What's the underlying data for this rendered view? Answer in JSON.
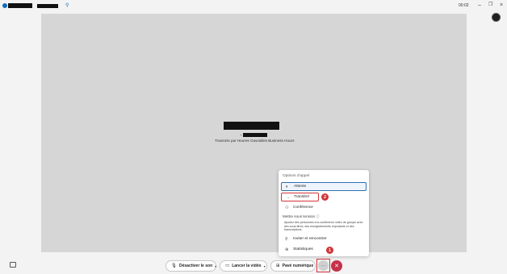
{
  "titlebar": {
    "phone_prefix": "+",
    "timer": "00:02",
    "window_controls": {
      "minimize": "–",
      "maximize": "❐",
      "close": "×"
    }
  },
  "call": {
    "caller_number_prefix": "+",
    "transfer_note": "Transmis par Heures Ouvrables Business Hours"
  },
  "menu": {
    "heading": "Options d'appel",
    "items": [
      {
        "label": "Attente",
        "icon": "pause-icon"
      },
      {
        "label": "Transfert",
        "icon": "transfer-arrow-icon"
      },
      {
        "label": "Conférence",
        "icon": "conference-icon"
      },
      {
        "label": "Inviter et rencontrer",
        "icon": "invite-person-icon"
      },
      {
        "label": "Statistiques",
        "icon": "stats-icon"
      }
    ],
    "sub_heading": "Mettre sous tension",
    "description": "Ajoutez des personnes à la conférence vidéo de groupe avec des sous-titres, des enregistrements importants et des transcriptions."
  },
  "badges": {
    "first": "1",
    "second": "2"
  },
  "toolbar": {
    "mute": "Désactiver le son",
    "video": "Lancer la vidéo",
    "dialpad": "Pavé numérique",
    "more": "···",
    "hangup": "✕"
  },
  "colors": {
    "accent": "#0f6cbd",
    "hangup": "#c4314b",
    "highlight": "#d13438",
    "stage": "#d6d6d6"
  }
}
